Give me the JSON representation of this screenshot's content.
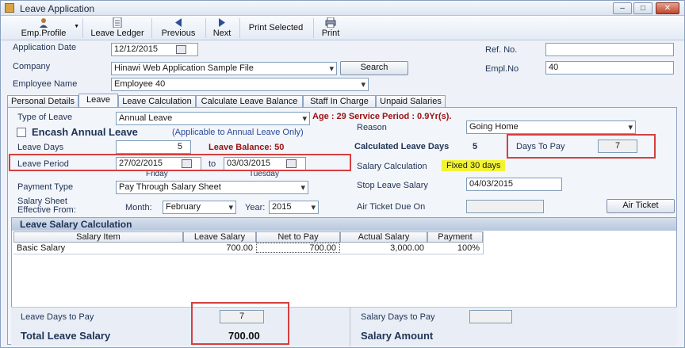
{
  "window": {
    "title": "Leave Application",
    "min": "–",
    "max": "□",
    "close": "✕"
  },
  "toolbar": {
    "emp_profile": "Emp.Profile",
    "leave_ledger": "Leave Ledger",
    "previous": "Previous",
    "next": "Next",
    "print_selected": "Print Selected",
    "print": "Print"
  },
  "header": {
    "application_date_label": "Application Date",
    "application_date": "12/12/2015",
    "company_label": "Company",
    "company": "Hinawi Web Application Sample File",
    "search_button": "Search",
    "employee_name_label": "Employee Name",
    "employee_name": "Employee 40",
    "ref_no_label": "Ref. No.",
    "ref_no": "",
    "empl_no_label": "Empl.No",
    "empl_no": "40"
  },
  "tabs": [
    "Personal Details",
    "Leave",
    "Leave Calculation",
    "Calculate Leave Balance",
    "Staff In Charge",
    "Unpaid Salaries"
  ],
  "leave": {
    "type_of_leave_label": "Type of Leave",
    "type_of_leave": "Annual Leave",
    "age_info": "Age : 29 Service Period : 0.9Yr(s).",
    "encash_label": "Encash Annual Leave",
    "encash_note": "(Applicable to Annual Leave Only)",
    "leave_days_label": "Leave Days",
    "leave_days": "5",
    "leave_balance": "Leave Balance: 50",
    "leave_period_label": "Leave Period",
    "from_date": "27/02/2015",
    "to_label": "to",
    "to_date": "03/03/2015",
    "from_day": "Friday",
    "to_day": "Tuesday",
    "payment_type_label": "Payment Type",
    "payment_type": "Pay Through Salary Sheet",
    "salary_sheet_label_1": "Salary Sheet",
    "salary_sheet_label_2": "Effective From:",
    "month_label": "Month:",
    "month": "February",
    "year_label": "Year:",
    "year": "2015",
    "reason_label": "Reason",
    "reason": "Going Home",
    "calc_days_label": "Calculated Leave Days",
    "calc_days": "5",
    "days_to_pay_label": "Days To Pay",
    "days_to_pay": "7",
    "salary_calc_label": "Salary Calculation",
    "salary_calc": "Fixed 30 days",
    "stop_salary_label": "Stop Leave Salary",
    "stop_salary": "04/03/2015",
    "air_ticket_due_label": "Air Ticket Due On",
    "air_ticket_due": "",
    "air_ticket_button": "Air Ticket"
  },
  "grid": {
    "title": "Leave Salary Calculation",
    "columns": [
      "Salary Item",
      "Leave Salary",
      "Net to Pay",
      "Actual Salary",
      "Payment"
    ],
    "rows": [
      [
        "Basic Salary",
        "700.00",
        "700.00",
        "3,000.00",
        "100%"
      ]
    ]
  },
  "footer": {
    "leave_days_to_pay_label": "Leave Days to Pay",
    "leave_days_to_pay": "7",
    "total_leave_salary_label": "Total Leave Salary",
    "total_leave_salary": "700.00",
    "salary_days_to_pay_label": "Salary Days to Pay",
    "salary_days_to_pay": "",
    "salary_amount_label": "Salary Amount"
  },
  "colors": {
    "highlight_box": "#d34040",
    "highlight_fill": "#f3f335",
    "label_red": "#9b1111",
    "label_blue": "#1f3355"
  }
}
